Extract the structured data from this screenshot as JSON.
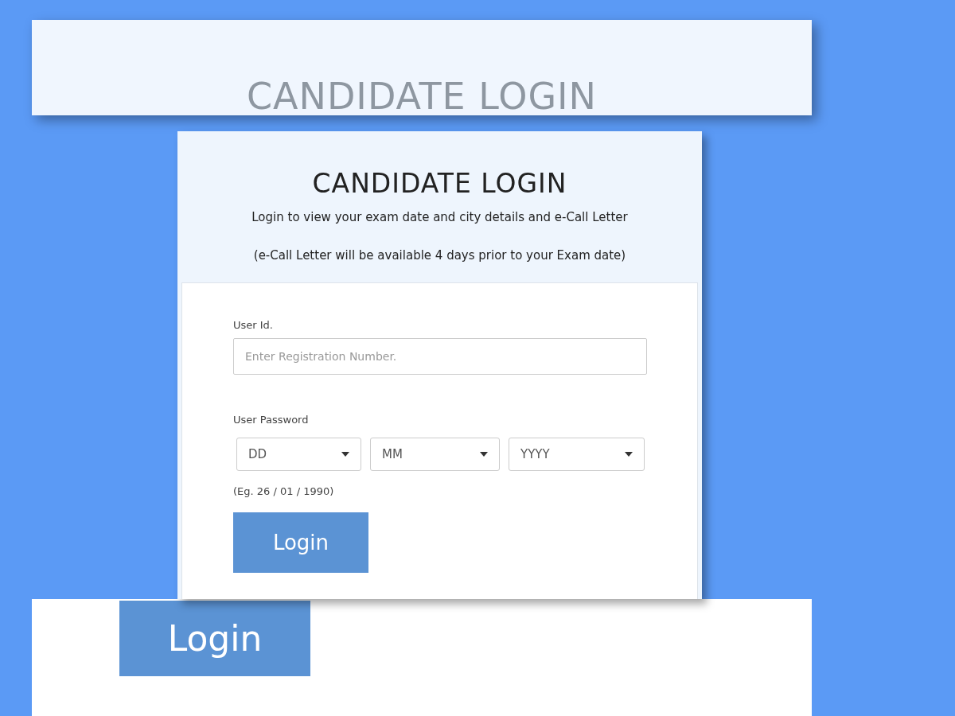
{
  "background": {
    "title": "CANDIDATE LOGIN",
    "button": "Login"
  },
  "card": {
    "title": "CANDIDATE LOGIN",
    "subtitle": "Login to view your exam date and city details and e-Call Letter",
    "note": "(e-Call Letter will be available 4 days prior to your Exam date)",
    "user_id": {
      "label": "User Id.",
      "placeholder": "Enter Registration Number."
    },
    "password": {
      "label": "User Password",
      "selects": [
        {
          "value": "DD"
        },
        {
          "value": "MM"
        },
        {
          "value": "YYYY"
        }
      ],
      "hint": "(Eg. 26 / 01 / 1990)"
    },
    "login_button": "Login"
  }
}
